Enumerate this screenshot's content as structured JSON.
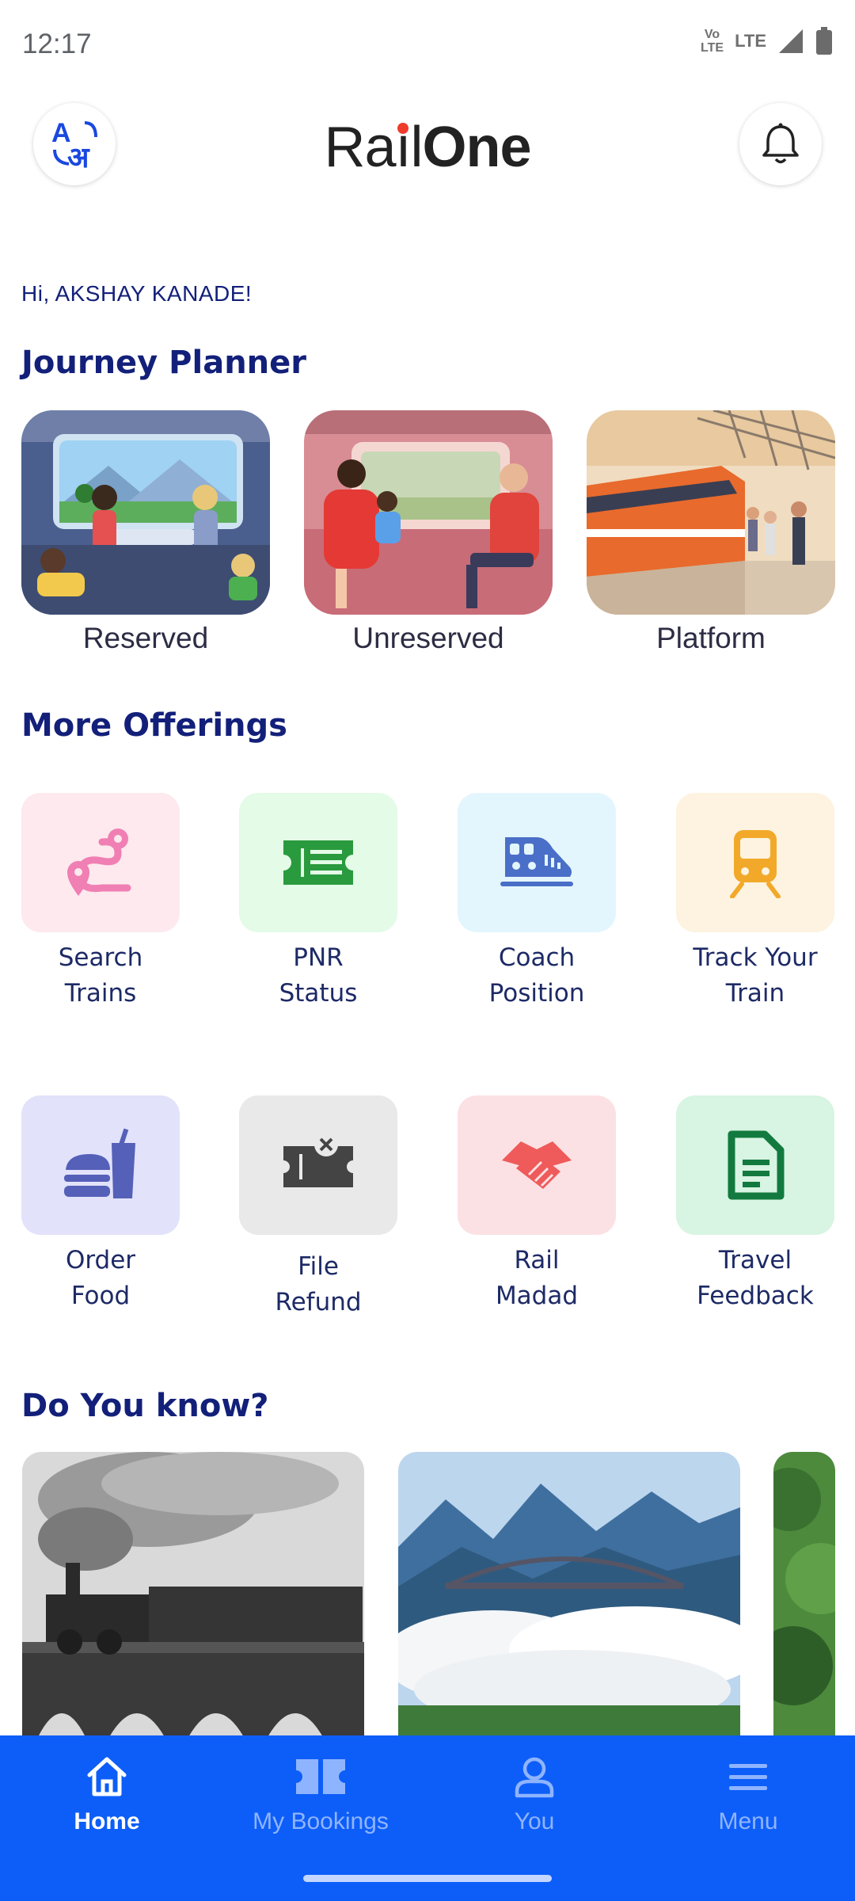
{
  "status_bar": {
    "time": "12:17",
    "volte": "Vo LTE",
    "network": "LTE"
  },
  "header": {
    "logo_part1": "Ra",
    "logo_part2": "l",
    "logo_part3": "One",
    "logo_i": "i",
    "lang_icon": "translate-icon",
    "bell_icon": "bell-icon"
  },
  "greeting": "Hi, AKSHAY KANADE!",
  "journey_planner": {
    "title": "Journey Planner",
    "items": [
      {
        "label": "Reserved"
      },
      {
        "label": "Unreserved"
      },
      {
        "label": "Platform"
      }
    ]
  },
  "more_offerings": {
    "title": "More Offerings",
    "items": [
      {
        "line1": "Search",
        "line2": "Trains",
        "icon": "route-icon",
        "bg": "#fde9ee",
        "color": "#f07fb3"
      },
      {
        "line1": "PNR",
        "line2": "Status",
        "icon": "ticket-icon",
        "bg": "#e3fbe7",
        "color": "#2a9a3e"
      },
      {
        "line1": "Coach",
        "line2": "Position",
        "icon": "train-engine-icon",
        "bg": "#e4f6fd",
        "color": "#4a6fc8"
      },
      {
        "line1": "Track Your",
        "line2": "Train",
        "icon": "train-front-icon",
        "bg": "#fdf3e0",
        "color": "#f2a92a"
      },
      {
        "line1": "Order",
        "line2": "Food",
        "icon": "food-icon",
        "bg": "#e2e2fb",
        "color": "#5560b8"
      },
      {
        "line1": "File",
        "line2": "Refund",
        "icon": "refund-ticket-icon",
        "bg": "#e9e9e9",
        "color": "#444444"
      },
      {
        "line1": "Rail",
        "line2": "Madad",
        "icon": "handshake-icon",
        "bg": "#fbe1e4",
        "color": "#ef5a5a"
      },
      {
        "line1": "Travel",
        "line2": "Feedback",
        "icon": "document-icon",
        "bg": "#d8f4e2",
        "color": "#127a3e"
      }
    ]
  },
  "do_you_know": {
    "title": "Do You know?"
  },
  "bottom_nav": {
    "items": [
      {
        "label": "Home",
        "icon": "home-icon",
        "active": true
      },
      {
        "label": "My Bookings",
        "icon": "bookings-icon",
        "active": false
      },
      {
        "label": "You",
        "icon": "user-icon",
        "active": false
      },
      {
        "label": "Menu",
        "icon": "menu-icon",
        "active": false
      }
    ]
  },
  "colors": {
    "accent": "#0d5ef8",
    "heading": "#13207a",
    "logo_dot": "#ef3b2c"
  }
}
